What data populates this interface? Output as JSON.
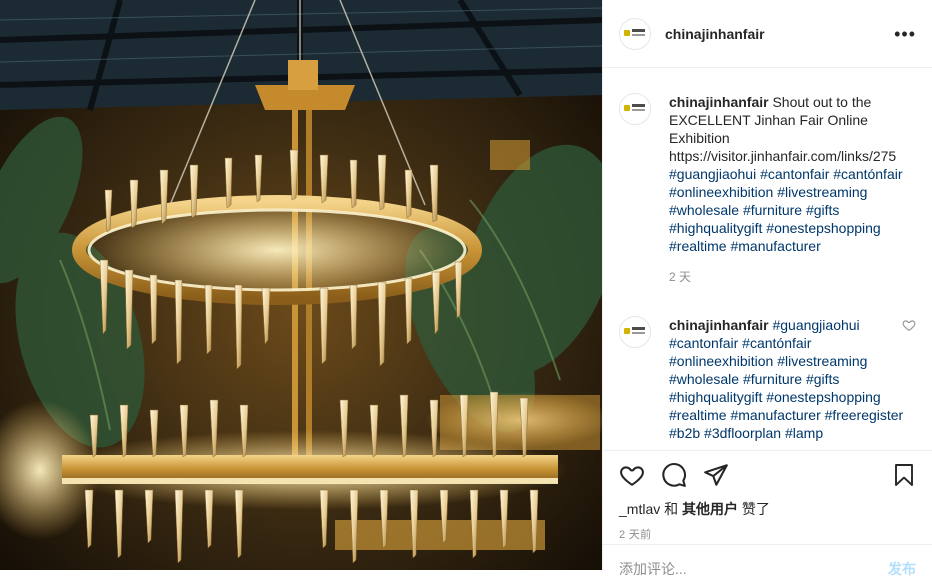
{
  "header": {
    "username": "chinajinhanfair",
    "more_label": "•••"
  },
  "comments": [
    {
      "username": "chinajinhanfair",
      "text": "Shout out to the EXCELLENT Jinhan Fair Online Exhibition",
      "link": "https://visitor.jinhanfair.com/links/275",
      "hashtags": "#guangjiaohui #cantonfair #cantónfair #onlineexhibition #livestreaming #wholesale #furniture #gifts #highqualitygift #onestepshopping #realtime #manufacturer",
      "time": "2 天"
    },
    {
      "username": "chinajinhanfair",
      "hashtags": "#guangjiaohui #cantonfair #cantónfair #onlineexhibition #livestreaming #wholesale #furniture #gifts #highqualitygift #onestepshopping #realtime #manufacturer #freeregister #b2b #3dfloorplan #lamp"
    }
  ],
  "likes": {
    "user": "_mtlav",
    "and": "和",
    "others": "其他用户",
    "suffix": "赞了"
  },
  "post_time": "2 天前",
  "add_comment": {
    "placeholder": "添加评论...",
    "post_label": "发布"
  },
  "colors": {
    "hashtag": "#00376b",
    "text": "#262626",
    "muted": "#8e8e8e"
  },
  "icons": [
    "more-icon",
    "heart-icon",
    "comment-icon",
    "share-icon",
    "bookmark-icon"
  ]
}
